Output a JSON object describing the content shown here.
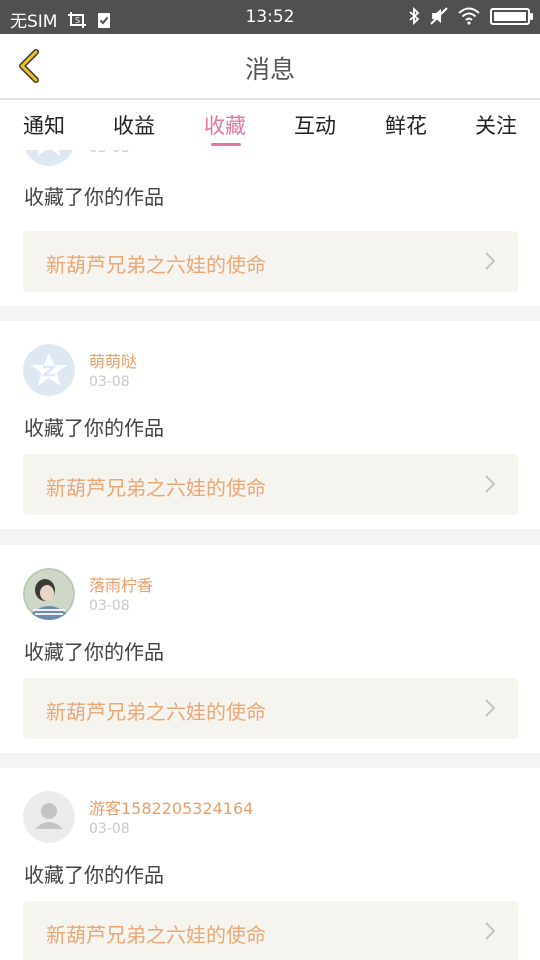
{
  "statusbar": {
    "carrier": "无SIM",
    "time": "13:52"
  },
  "header": {
    "title": "消息"
  },
  "tabs": [
    {
      "label": "通知"
    },
    {
      "label": "收益"
    },
    {
      "label": "收藏"
    },
    {
      "label": "互动"
    },
    {
      "label": "鲜花"
    },
    {
      "label": "关注"
    }
  ],
  "active_tab": "收藏",
  "colors": {
    "accent": "#e577a8",
    "username": "#e8a06a",
    "work_title": "#eba676"
  },
  "messages": [
    {
      "user": "",
      "date": "03-08",
      "action": "收藏了你的作品",
      "work": "新葫芦兄弟之六娃的使命",
      "avatar": "qzone-star-icon"
    },
    {
      "user": "萌萌哒",
      "date": "03-08",
      "action": "收藏了你的作品",
      "work": "新葫芦兄弟之六娃的使命",
      "avatar": "qzone-star-icon"
    },
    {
      "user": "落雨柠香",
      "date": "03-08",
      "action": "收藏了你的作品",
      "work": "新葫芦兄弟之六娃的使命",
      "avatar": "photo-avatar"
    },
    {
      "user": "游客1582205324164",
      "date": "03-08",
      "action": "收藏了你的作品",
      "work": "新葫芦兄弟之六娃的使命",
      "avatar": "default-person-icon"
    }
  ]
}
